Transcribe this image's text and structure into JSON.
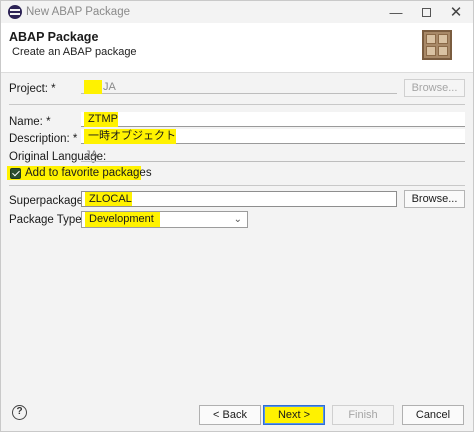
{
  "window": {
    "title": "New ABAP Package"
  },
  "header": {
    "title": "ABAP Package",
    "subtitle": "Create an ABAP package"
  },
  "form": {
    "project": {
      "label": "Project: *",
      "value": "JA",
      "browse_label": "Browse..."
    },
    "name": {
      "label": "Name: *",
      "value": "ZTMP"
    },
    "description": {
      "label": "Description: *",
      "value": "一時オブジェクト"
    },
    "original_language": {
      "label": "Original Language:",
      "value": "JA"
    },
    "favorites": {
      "label": "Add to favorite packages",
      "checked": true
    },
    "superpackage": {
      "label": "Superpackage:",
      "value": "ZLOCAL",
      "browse_label": "Browse..."
    },
    "package_type": {
      "label": "Package Type: *",
      "selected": "Development"
    }
  },
  "footer": {
    "help_icon": "question-mark",
    "back_label": "< Back",
    "next_label": "Next >",
    "finish_label": "Finish",
    "cancel_label": "Cancel"
  },
  "colors": {
    "highlight": "#fff200",
    "primary_border": "#2f6fd6",
    "checkbox": "#2c4d2f"
  }
}
